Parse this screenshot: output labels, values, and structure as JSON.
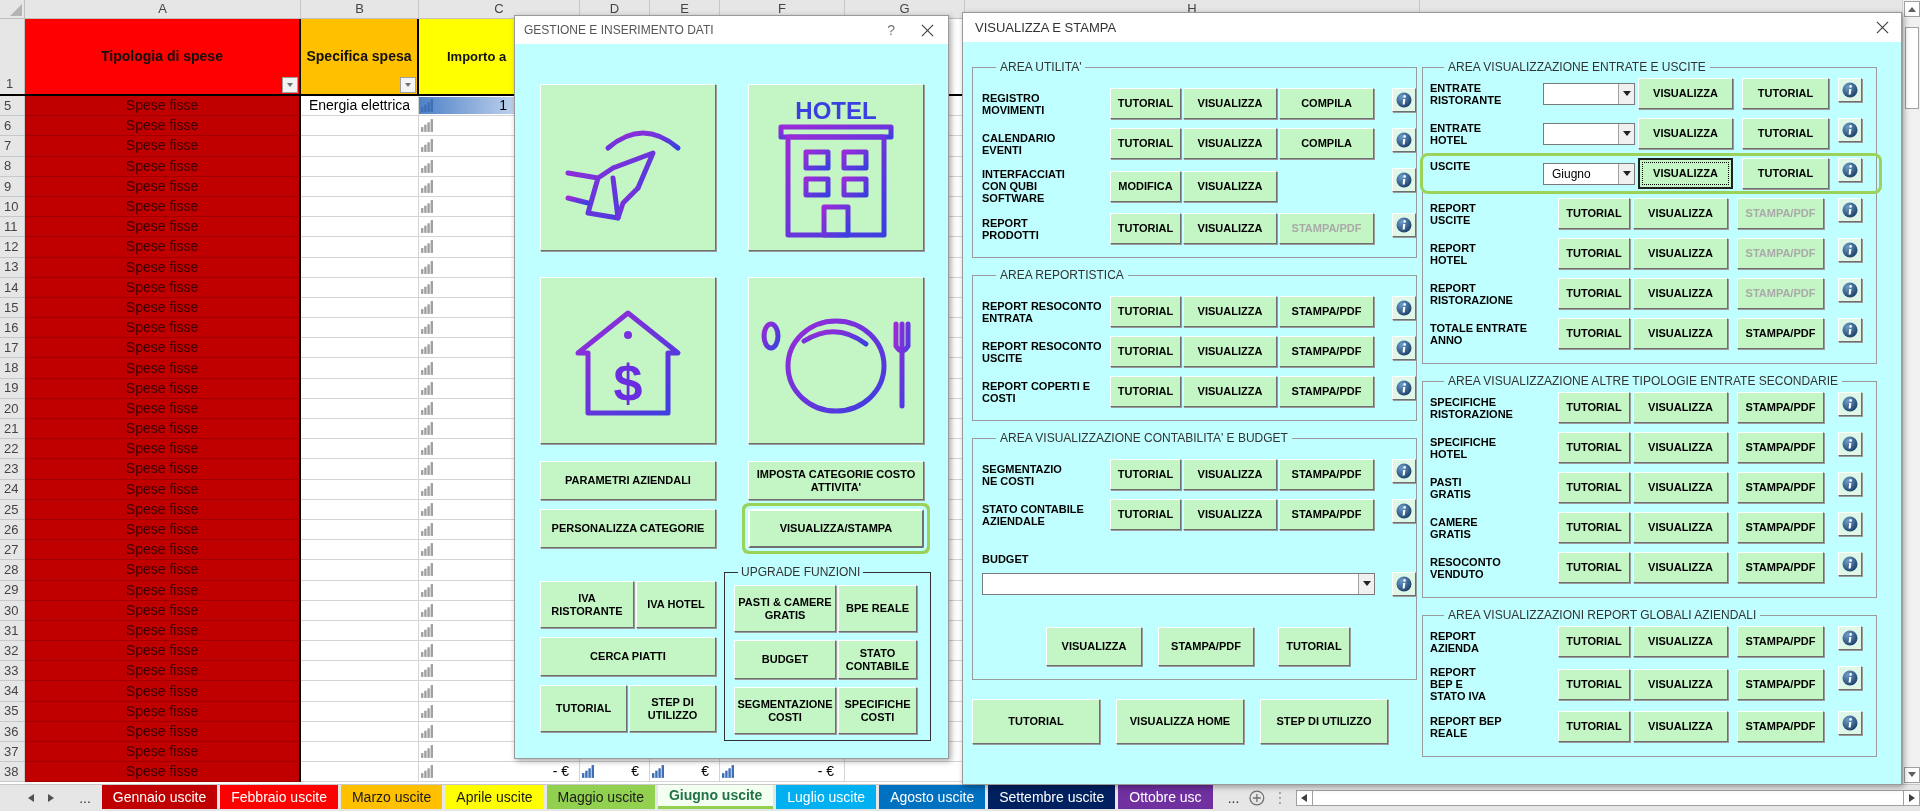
{
  "sheet": {
    "columns": [
      {
        "label": "A"
      },
      {
        "label": "B"
      },
      {
        "label": "C"
      },
      {
        "label": "D"
      },
      {
        "label": "E"
      },
      {
        "label": "F"
      },
      {
        "label": "G"
      },
      {
        "label": "H"
      }
    ],
    "header_row": {
      "number": "1",
      "cells": [
        {
          "text": "Tipologia di spese",
          "color": "#ff0000",
          "filter": true
        },
        {
          "text": "Specifica spesa",
          "color": "#ffc000",
          "filter": true
        },
        {
          "text": "Importo a",
          "color": "#ffff00"
        }
      ]
    },
    "rows": [
      {
        "number": "5",
        "type": "Spese fisse",
        "detail": "Energia elettrica",
        "amount": {
          "value": "1",
          "bars_filled": true,
          "data_bar": true
        }
      },
      {
        "number": "6",
        "type": "Spese fisse",
        "amount": {
          "bars_filled": false,
          "data_bar": false
        }
      },
      {
        "number": "7",
        "type": "Spese fisse",
        "amount": {
          "bars_filled": false,
          "data_bar": false
        }
      },
      {
        "number": "8",
        "type": "Spese fisse",
        "amount": {
          "bars_filled": false,
          "data_bar": false
        }
      },
      {
        "number": "9",
        "type": "Spese fisse",
        "amount": {
          "bars_filled": false,
          "data_bar": false
        }
      },
      {
        "number": "10",
        "type": "Spese fisse",
        "amount": {
          "bars_filled": false,
          "data_bar": false
        }
      },
      {
        "number": "11",
        "type": "Spese fisse",
        "amount": {
          "bars_filled": false,
          "data_bar": false
        }
      },
      {
        "number": "12",
        "type": "Spese fisse",
        "amount": {
          "bars_filled": false,
          "data_bar": false
        }
      },
      {
        "number": "13",
        "type": "Spese fisse",
        "amount": {
          "bars_filled": false,
          "data_bar": false
        }
      },
      {
        "number": "14",
        "type": "Spese fisse",
        "amount": {
          "bars_filled": false,
          "data_bar": false
        }
      },
      {
        "number": "15",
        "type": "Spese fisse",
        "amount": {
          "bars_filled": false,
          "data_bar": false
        }
      },
      {
        "number": "16",
        "type": "Spese fisse",
        "amount": {
          "bars_filled": false,
          "data_bar": false
        }
      },
      {
        "number": "17",
        "type": "Spese fisse",
        "amount": {
          "bars_filled": false,
          "data_bar": false
        }
      },
      {
        "number": "18",
        "type": "Spese fisse",
        "amount": {
          "bars_filled": false,
          "data_bar": false
        }
      },
      {
        "number": "19",
        "type": "Spese fisse",
        "amount": {
          "bars_filled": false,
          "data_bar": false
        }
      },
      {
        "number": "20",
        "type": "Spese fisse",
        "amount": {
          "bars_filled": false,
          "data_bar": false
        }
      },
      {
        "number": "21",
        "type": "Spese fisse",
        "amount": {
          "bars_filled": false,
          "data_bar": false
        }
      },
      {
        "number": "22",
        "type": "Spese fisse",
        "amount": {
          "bars_filled": false,
          "data_bar": false
        }
      },
      {
        "number": "23",
        "type": "Spese fisse",
        "amount": {
          "bars_filled": false,
          "data_bar": false
        }
      },
      {
        "number": "24",
        "type": "Spese fisse",
        "amount": {
          "bars_filled": false,
          "data_bar": false
        }
      },
      {
        "number": "25",
        "type": "Spese fisse",
        "amount": {
          "bars_filled": false,
          "data_bar": false
        }
      },
      {
        "number": "26",
        "type": "Spese fisse",
        "amount": {
          "bars_filled": false,
          "data_bar": false
        }
      },
      {
        "number": "27",
        "type": "Spese fisse",
        "amount": {
          "bars_filled": false,
          "data_bar": false
        }
      },
      {
        "number": "28",
        "type": "Spese fisse",
        "amount": {
          "bars_filled": false,
          "data_bar": false
        }
      },
      {
        "number": "29",
        "type": "Spese fisse",
        "amount": {
          "bars_filled": false,
          "data_bar": false
        }
      },
      {
        "number": "30",
        "type": "Spese fisse",
        "amount": {
          "bars_filled": false,
          "data_bar": false
        }
      },
      {
        "number": "31",
        "type": "Spese fisse",
        "amount": {
          "bars_filled": false,
          "data_bar": false
        }
      },
      {
        "number": "32",
        "type": "Spese fisse",
        "amount": {
          "bars_filled": false,
          "data_bar": false
        }
      },
      {
        "number": "33",
        "type": "Spese fisse",
        "amount": {
          "bars_filled": false,
          "data_bar": false
        }
      },
      {
        "number": "34",
        "type": "Spese fisse",
        "amount": {
          "bars_filled": false,
          "data_bar": false
        }
      },
      {
        "number": "35",
        "type": "Spese fisse",
        "amount": {
          "bars_filled": false,
          "data_bar": false
        }
      },
      {
        "number": "36",
        "type": "Spese fisse",
        "amount": {
          "bars_filled": false,
          "data_bar": false
        }
      },
      {
        "number": "37",
        "type": "Spese fisse",
        "amount": {
          "bars_filled": false,
          "data_bar": false
        }
      },
      {
        "number": "38",
        "type": "Spese fisse",
        "amount": {
          "value": "- €",
          "bars_filled": false,
          "data_bar": false
        },
        "extra": [
          {
            "value": "€",
            "bars_filled": true
          },
          {
            "value": "€",
            "bars_filled": true
          },
          {
            "value": "- €",
            "bars_filled": true
          }
        ]
      }
    ]
  },
  "data_dialog": {
    "title": "GESTIONE E INSERIMENTO DATI",
    "help": "?",
    "tiles": [
      {
        "kind": "waiter"
      },
      {
        "kind": "hotel",
        "sign": "HOTEL"
      },
      {
        "kind": "house",
        "symbol": "$"
      },
      {
        "kind": "plate"
      }
    ],
    "left_buttons": [
      {
        "label": "PARAMETRI AZIENDALI",
        "highlighted": false
      },
      {
        "label": "PERSONALIZZA CATEGORIE",
        "highlighted": false
      }
    ],
    "right_buttons": [
      {
        "label": "IMPOSTA CATEGORIE COSTO\nATTIVITA'",
        "highlighted": false
      },
      {
        "label": "VISUALIZZA/STAMPA",
        "highlighted": true
      }
    ],
    "tool_rows": [
      [
        {
          "label": "IVA\nRISTORANTE"
        },
        {
          "label": "IVA HOTEL"
        }
      ],
      [
        {
          "label": "CERCA PIATTI"
        }
      ],
      [
        {
          "label": "TUTORIAL"
        },
        {
          "label": "STEP DI\nUTILIZZO"
        }
      ]
    ],
    "upgrade": {
      "title": "UPGRADE FUNZIONI",
      "rows": [
        [
          {
            "label": "PASTI & CAMERE\nGRATIS"
          },
          {
            "label": "BPE REALE"
          }
        ],
        [
          {
            "label": "BUDGET"
          },
          {
            "label": "STATO\nCONTABILE"
          }
        ],
        [
          {
            "label": "SEGMENTAZIONE\nCOSTI"
          },
          {
            "label": "SPECIFICHE\nCOSTI"
          }
        ]
      ]
    }
  },
  "print_dialog": {
    "title": "VISUALIZZA E STAMPA",
    "left_groups": [
      {
        "title": "AREA UTILITA'",
        "rows": [
          {
            "label": "REGISTRO\nMOVIMENTI",
            "highlighted": false,
            "items": [
              {
                "kind": "button",
                "label": "TUTORIAL",
                "disabled": false,
                "focused": false
              },
              {
                "kind": "button",
                "label": "VISUALIZZA",
                "disabled": false,
                "focused": false
              },
              {
                "kind": "button",
                "label": "COMPILA",
                "disabled": false,
                "focused": false
              }
            ]
          },
          {
            "label": "CALENDARIO\nEVENTI",
            "highlighted": false,
            "items": [
              {
                "kind": "button",
                "label": "TUTORIAL",
                "disabled": false,
                "focused": false
              },
              {
                "kind": "button",
                "label": "VISUALIZZA",
                "disabled": false,
                "focused": false
              },
              {
                "kind": "button",
                "label": "COMPILA",
                "disabled": false,
                "focused": false
              }
            ]
          },
          {
            "label": "INTERFACCIATI\nCON QUBI\nSOFTWARE",
            "highlighted": false,
            "items": [
              {
                "kind": "button",
                "label": "MODIFICA",
                "disabled": false,
                "focused": false
              },
              {
                "kind": "button",
                "label": "VISUALIZZA",
                "disabled": false,
                "focused": false
              }
            ]
          },
          {
            "label": "REPORT\nPRODOTTI",
            "highlighted": false,
            "items": [
              {
                "kind": "button",
                "label": "TUTORIAL",
                "disabled": false,
                "focused": false
              },
              {
                "kind": "button",
                "label": "VISUALIZZA",
                "disabled": false,
                "focused": false
              },
              {
                "kind": "button",
                "label": "STAMPA/PDF",
                "disabled": true,
                "focused": false
              }
            ]
          }
        ]
      },
      {
        "title": "AREA REPORTISTICA",
        "rows": [
          {
            "label": "REPORT RESOCONTO\nENTRATA",
            "highlighted": false,
            "items": [
              {
                "kind": "button",
                "label": "TUTORIAL",
                "disabled": false,
                "focused": false
              },
              {
                "kind": "button",
                "label": "VISUALIZZA",
                "disabled": false,
                "focused": false
              },
              {
                "kind": "button",
                "label": "STAMPA/PDF",
                "disabled": false,
                "focused": false
              }
            ]
          },
          {
            "label": "REPORT RESOCONTO\nUSCITE",
            "highlighted": false,
            "items": [
              {
                "kind": "button",
                "label": "TUTORIAL",
                "disabled": false,
                "focused": false
              },
              {
                "kind": "button",
                "label": "VISUALIZZA",
                "disabled": false,
                "focused": false
              },
              {
                "kind": "button",
                "label": "STAMPA/PDF",
                "disabled": false,
                "focused": false
              }
            ]
          },
          {
            "label": "REPORT COPERTI E\nCOSTI",
            "highlighted": false,
            "items": [
              {
                "kind": "button",
                "label": "TUTORIAL",
                "disabled": false,
                "focused": false
              },
              {
                "kind": "button",
                "label": "VISUALIZZA",
                "disabled": false,
                "focused": false
              },
              {
                "kind": "button",
                "label": "STAMPA/PDF",
                "disabled": false,
                "focused": false
              }
            ]
          }
        ]
      },
      {
        "title": "AREA VISUALIZZAZIONE CONTABILITA' E BUDGET",
        "rows": [
          {
            "label": "SEGMENTAZIO\nNE COSTI",
            "highlighted": false,
            "items": [
              {
                "kind": "button",
                "label": "TUTORIAL",
                "disabled": false,
                "focused": false
              },
              {
                "kind": "button",
                "label": "VISUALIZZA",
                "disabled": false,
                "focused": false
              },
              {
                "kind": "button",
                "label": "STAMPA/PDF",
                "disabled": false,
                "focused": false
              }
            ]
          },
          {
            "label": "STATO CONTABILE\nAZIENDALE",
            "highlighted": false,
            "items": [
              {
                "kind": "button",
                "label": "TUTORIAL",
                "disabled": false,
                "focused": false
              },
              {
                "kind": "button",
                "label": "VISUALIZZA",
                "disabled": false,
                "focused": false
              },
              {
                "kind": "button",
                "label": "STAMPA/PDF",
                "disabled": false,
                "focused": false
              }
            ]
          }
        ],
        "budget": {
          "label": "BUDGET",
          "actions": [
            {
              "label": "VISUALIZZA"
            },
            {
              "label": "STAMPA/PDF"
            },
            {
              "label": "TUTORIAL"
            }
          ]
        }
      }
    ],
    "right_groups": [
      {
        "title": "AREA VISUALIZZAZIONE ENTRATE E USCITE",
        "rows": [
          {
            "label": "ENTRATE\nRISTORANTE",
            "highlighted": false,
            "items": [
              {
                "kind": "dropdown"
              },
              {
                "kind": "button",
                "label": "VISUALIZZA",
                "disabled": false,
                "focused": false
              },
              {
                "kind": "button",
                "label": "TUTORIAL",
                "disabled": false,
                "focused": false
              }
            ]
          },
          {
            "label": "ENTRATE\nHOTEL",
            "highlighted": false,
            "items": [
              {
                "kind": "dropdown"
              },
              {
                "kind": "button",
                "label": "VISUALIZZA",
                "disabled": false,
                "focused": false
              },
              {
                "kind": "button",
                "label": "TUTORIAL",
                "disabled": false,
                "focused": false
              }
            ]
          },
          {
            "label": "USCITE",
            "highlighted": true,
            "items": [
              {
                "kind": "dropdown",
                "value": "Giugno"
              },
              {
                "kind": "button",
                "label": "VISUALIZZA",
                "disabled": false,
                "focused": true
              },
              {
                "kind": "button",
                "label": "TUTORIAL",
                "disabled": false,
                "focused": false
              }
            ]
          },
          {
            "label": "REPORT\nUSCITE",
            "highlighted": false,
            "items": [
              {
                "kind": "button",
                "label": "TUTORIAL",
                "disabled": false,
                "focused": false
              },
              {
                "kind": "button",
                "label": "VISUALIZZA",
                "disabled": false,
                "focused": false
              },
              {
                "kind": "button",
                "label": "STAMPA/PDF",
                "disabled": true,
                "focused": false
              }
            ]
          },
          {
            "label": "REPORT\nHOTEL",
            "highlighted": false,
            "items": [
              {
                "kind": "button",
                "label": "TUTORIAL",
                "disabled": false,
                "focused": false
              },
              {
                "kind": "button",
                "label": "VISUALIZZA",
                "disabled": false,
                "focused": false
              },
              {
                "kind": "button",
                "label": "STAMPA/PDF",
                "disabled": true,
                "focused": false
              }
            ]
          },
          {
            "label": "REPORT\nRISTORAZIONE",
            "highlighted": false,
            "items": [
              {
                "kind": "button",
                "label": "TUTORIAL",
                "disabled": false,
                "focused": false
              },
              {
                "kind": "button",
                "label": "VISUALIZZA",
                "disabled": false,
                "focused": false
              },
              {
                "kind": "button",
                "label": "STAMPA/PDF",
                "disabled": true,
                "focused": false
              }
            ]
          },
          {
            "label": "TOTALE ENTRATE\nANNO",
            "highlighted": false,
            "items": [
              {
                "kind": "button",
                "label": "TUTORIAL",
                "disabled": false,
                "focused": false
              },
              {
                "kind": "button",
                "label": "VISUALIZZA",
                "disabled": false,
                "focused": false
              },
              {
                "kind": "button",
                "label": "STAMPA/PDF",
                "disabled": false,
                "focused": false
              }
            ]
          }
        ]
      },
      {
        "title": "AREA VISUALIZZAZIONE ALTRE TIPOLOGIE ENTRATE SECONDARIE",
        "rows": [
          {
            "label": "SPECIFICHE\nRISTORAZIONE",
            "highlighted": false,
            "items": [
              {
                "kind": "button",
                "label": "TUTORIAL",
                "disabled": false,
                "focused": false
              },
              {
                "kind": "button",
                "label": "VISUALIZZA",
                "disabled": false,
                "focused": false
              },
              {
                "kind": "button",
                "label": "STAMPA/PDF",
                "disabled": false,
                "focused": false
              }
            ]
          },
          {
            "label": "SPECIFICHE\nHOTEL",
            "highlighted": false,
            "items": [
              {
                "kind": "button",
                "label": "TUTORIAL",
                "disabled": false,
                "focused": false
              },
              {
                "kind": "button",
                "label": "VISUALIZZA",
                "disabled": false,
                "focused": false
              },
              {
                "kind": "button",
                "label": "STAMPA/PDF",
                "disabled": false,
                "focused": false
              }
            ]
          },
          {
            "label": "PASTI\nGRATIS",
            "highlighted": false,
            "items": [
              {
                "kind": "button",
                "label": "TUTORIAL",
                "disabled": false,
                "focused": false
              },
              {
                "kind": "button",
                "label": "VISUALIZZA",
                "disabled": false,
                "focused": false
              },
              {
                "kind": "button",
                "label": "STAMPA/PDF",
                "disabled": false,
                "focused": false
              }
            ]
          },
          {
            "label": "CAMERE\nGRATIS",
            "highlighted": false,
            "items": [
              {
                "kind": "button",
                "label": "TUTORIAL",
                "disabled": false,
                "focused": false
              },
              {
                "kind": "button",
                "label": "VISUALIZZA",
                "disabled": false,
                "focused": false
              },
              {
                "kind": "button",
                "label": "STAMPA/PDF",
                "disabled": false,
                "focused": false
              }
            ]
          },
          {
            "label": "RESOCONTO\nVENDUTO",
            "highlighted": false,
            "items": [
              {
                "kind": "button",
                "label": "TUTORIAL",
                "disabled": false,
                "focused": false
              },
              {
                "kind": "button",
                "label": "VISUALIZZA",
                "disabled": false,
                "focused": false
              },
              {
                "kind": "button",
                "label": "STAMPA/PDF",
                "disabled": false,
                "focused": false
              }
            ]
          }
        ]
      },
      {
        "title": "AREA VISUALIZZAZIONI REPORT GLOBALI AZIENDALI",
        "rows": [
          {
            "label": "REPORT\nAZIENDA",
            "highlighted": false,
            "items": [
              {
                "kind": "button",
                "label": "TUTORIAL",
                "disabled": false,
                "focused": false
              },
              {
                "kind": "button",
                "label": "VISUALIZZA",
                "disabled": false,
                "focused": false
              },
              {
                "kind": "button",
                "label": "STAMPA/PDF",
                "disabled": false,
                "focused": false
              }
            ]
          },
          {
            "label": "REPORT\nBEP E\nSTATO IVA",
            "highlighted": false,
            "items": [
              {
                "kind": "button",
                "label": "TUTORIAL",
                "disabled": false,
                "focused": false
              },
              {
                "kind": "button",
                "label": "VISUALIZZA",
                "disabled": false,
                "focused": false
              },
              {
                "kind": "button",
                "label": "STAMPA/PDF",
                "disabled": false,
                "focused": false
              }
            ]
          },
          {
            "label": "REPORT BEP\nREALE",
            "highlighted": false,
            "items": [
              {
                "kind": "button",
                "label": "TUTORIAL",
                "disabled": false,
                "focused": false
              },
              {
                "kind": "button",
                "label": "VISUALIZZA",
                "disabled": false,
                "focused": false
              },
              {
                "kind": "button",
                "label": "STAMPA/PDF",
                "disabled": false,
                "focused": false
              }
            ]
          }
        ]
      }
    ],
    "bottom_buttons": [
      {
        "label": "TUTORIAL"
      },
      {
        "label": "VISUALIZZA HOME"
      },
      {
        "label": "STEP DI UTILIZZO"
      }
    ]
  },
  "sheet_tabs": {
    "more_left": "...",
    "more_right": "...",
    "tabs": [
      {
        "label": "Gennaio uscite",
        "color": "#c00000",
        "selected": false
      },
      {
        "label": "Febbraio uscite",
        "color": "#ff0000",
        "selected": false
      },
      {
        "label": "Marzo uscite",
        "color": "#ffc000",
        "selected": false
      },
      {
        "label": "Aprile uscite",
        "color": "#ffff00",
        "selected": false
      },
      {
        "label": "Maggio uscite",
        "color": "#92d050",
        "selected": false
      },
      {
        "label": "Giugno uscite",
        "color": "#92d050",
        "selected": true
      },
      {
        "label": "Luglio uscite",
        "color": "#00b0f0",
        "selected": false
      },
      {
        "label": "Agosto uscite",
        "color": "#0070c0",
        "selected": false
      },
      {
        "label": "Settembre uscite",
        "color": "#002060",
        "selected": false
      },
      {
        "label": "Ottobre usc",
        "color": "#7030a0",
        "selected": false
      }
    ]
  }
}
